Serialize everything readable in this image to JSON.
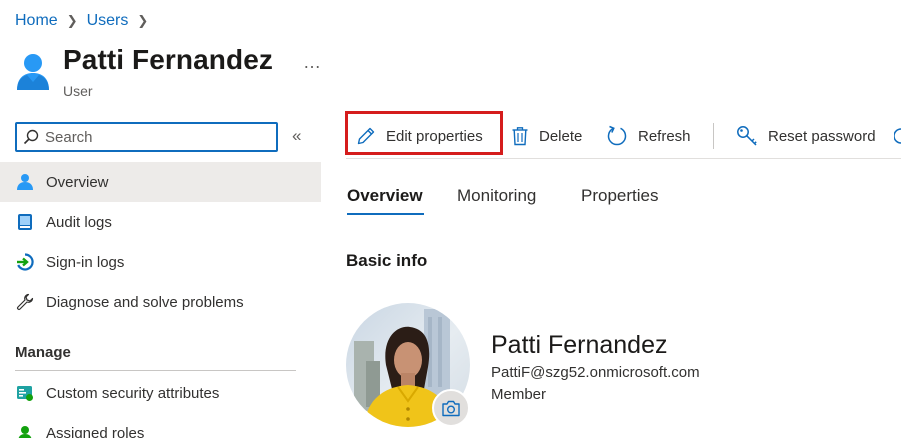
{
  "breadcrumb": {
    "items": [
      "Home",
      "Users"
    ]
  },
  "header": {
    "title": "Patti Fernandez",
    "subtitle": "User",
    "more_icon": "more-icon"
  },
  "sidebar": {
    "search_placeholder": "Search",
    "items": [
      {
        "label": "Overview",
        "icon": "user-icon",
        "active": true
      },
      {
        "label": "Audit logs",
        "icon": "audit-log-icon"
      },
      {
        "label": "Sign-in logs",
        "icon": "sign-in-icon"
      },
      {
        "label": "Diagnose and solve problems",
        "icon": "wrench-icon"
      }
    ],
    "section_manage": "Manage",
    "manage_items": [
      {
        "label": "Custom security attributes",
        "icon": "security-attributes-icon"
      },
      {
        "label": "Assigned roles",
        "icon": "roles-icon"
      }
    ]
  },
  "toolbar": {
    "edit_label": "Edit properties",
    "delete_label": "Delete",
    "refresh_label": "Refresh",
    "reset_password_label": "Reset password"
  },
  "tabs": [
    {
      "label": "Overview",
      "active": true
    },
    {
      "label": "Monitoring"
    },
    {
      "label": "Properties"
    }
  ],
  "basic_info": {
    "title": "Basic info",
    "name": "Patti Fernandez",
    "email": "PattiF@szg52.onmicrosoft.com",
    "user_type": "Member"
  },
  "colors": {
    "accent": "#0f6cbd",
    "highlight": "#d51c1c",
    "active_nav": "#edebe9"
  }
}
